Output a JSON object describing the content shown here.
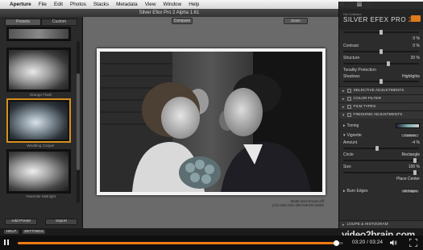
{
  "menubar": {
    "app": "Aperture",
    "items": [
      "File",
      "Edit",
      "Photos",
      "Stacks",
      "Metadata",
      "View",
      "Window",
      "Help"
    ]
  },
  "window": {
    "title": "Silver Efex Pro 2 Alpha 1.61"
  },
  "left_panel": {
    "tabs": [
      "Presets",
      "Custom"
    ],
    "thumbnails": [
      {
        "label": ""
      },
      {
        "label": "Orange Flash"
      },
      {
        "label": "Wedding Cooper"
      },
      {
        "label": "Yosemite Midnight"
      }
    ],
    "selected_index": 2,
    "add_preset_label": "Add Preset",
    "import_label": "Import"
  },
  "center": {
    "compare_label": "Compare",
    "zoom_label": "Zoom",
    "caption_title": "Bride and Groom.tiff",
    "caption_meta": "1/13 Sek  ISO 400  NIKON D600"
  },
  "right_panel": {
    "brand_small": "Nik Software",
    "brand_name": "SILVER EFEX PRO",
    "brand_version": "2",
    "brightness_value": "0 %",
    "contrast_label": "Contrast",
    "contrast_value": "0 %",
    "structure_label": "Structure",
    "structure_value": "20 %",
    "tonality_label": "Tonality Protection",
    "shadows_label": "Shadows",
    "highlights_label": "Highlights",
    "sections": [
      "SELECTIVE ADJUSTMENTS",
      "COLOR FILTER",
      "FILM TYPES",
      "FINISHING ADJUSTMENTS"
    ],
    "toning_label": "Toning",
    "vignette_label": "Vignette",
    "vignette_preset": "Custom",
    "amount_label": "Amount",
    "amount_value": "-4 %",
    "circle_label": "Circle",
    "rectangle_label": "Rectangle",
    "size_label": "Size",
    "size_value": "100 %",
    "place_center_label": "Place Center",
    "burn_edges_label": "Burn Edges",
    "burn_edges_preset": "All Edges",
    "loupe_label": "LOUPE & HISTOGRAM",
    "sliders": {
      "brightness": 0.5,
      "contrast": 0.5,
      "structure": 0.6,
      "tonality": 0.5,
      "amount": 0.45,
      "circle_rect": 0.95,
      "size": 0.95
    }
  },
  "bottom": {
    "help_label": "HELP",
    "settings_label": "SETTINGS"
  },
  "player": {
    "time": "03:20 / 03:24",
    "progress": 0.98,
    "watermark": "video2brain.com",
    "accent": "#f07a14"
  }
}
